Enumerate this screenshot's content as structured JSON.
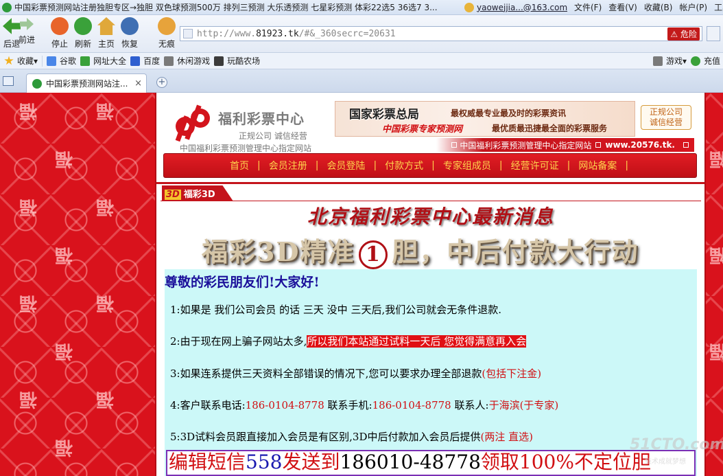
{
  "window": {
    "title": "中国彩票预测网站注册独胆专区→独胆 双色球预测500万 排列三预测 大乐透预测 七星彩预测 体彩22选5 36选7 3...",
    "user_email": "yaowejjia...@163.com",
    "menu": [
      "文件(F)",
      "查看(V)",
      "收藏(B)",
      "帐户(P)",
      "工具"
    ]
  },
  "toolbar": {
    "buttons": [
      {
        "label": "后退",
        "icon": "back-arrow-icon",
        "color": "#3a9c2f"
      },
      {
        "label": "前进",
        "icon": "forward-arrow-icon",
        "color": "#9fc798"
      },
      {
        "label": "停止",
        "icon": "stop-icon",
        "color": "#e8642a"
      },
      {
        "label": "刷新",
        "icon": "refresh-icon",
        "color": "#3aa13a"
      },
      {
        "label": "主页",
        "icon": "home-icon",
        "color": "#e0a83a"
      },
      {
        "label": "恢复",
        "icon": "restore-icon",
        "color": "#3f6fb3"
      },
      {
        "label": "无痕",
        "icon": "paw-icon",
        "color": "#e7a33b"
      }
    ],
    "address": {
      "prefix": "http://www.",
      "domain": "81923.tk",
      "suffix": "/#&_360secrc=20631",
      "danger_label": "危险"
    }
  },
  "favorites": {
    "items": [
      "收藏",
      "谷歌",
      "网址大全",
      "百度",
      "休闲游戏",
      "玩酷农场"
    ],
    "right": [
      "游戏",
      "充值"
    ]
  },
  "tabs": {
    "active_title": "中国彩票预测网站注...",
    "close": "×",
    "new": "+"
  },
  "site": {
    "logo_name": "福利彩票中心",
    "logo_slogan": "正规公司 诚信经营",
    "logo_sub": "中国福利彩票预测管理中心指定网站",
    "banner_title": "国家彩票总局",
    "banner_sub": "中国彩票专家预测网",
    "banner_t1": "最权威最专业最及时的彩票资讯",
    "banner_t2": "最优质最迅捷最全面的彩票服务",
    "badge_line1": "正规公司",
    "badge_line2": "诚信经营",
    "strip_text": "中国福利彩票预测管理中心指定网站",
    "strip_url": "www.20576.tk.",
    "nav": [
      "首页",
      "会员注册",
      "会员登陆",
      "付款方式",
      "专家组成员",
      "经营许可证",
      "网站备案"
    ],
    "nav_sep": "|"
  },
  "content": {
    "section_3d": "3D",
    "section_label": "福彩3D",
    "headline": "北京福利彩票中心最新消息",
    "slogan_pre": "福彩3D精准",
    "slogan_num": "1",
    "slogan_post": "胆，中后付款大行动",
    "greeting": "尊敬的彩民朋友们!大家好!",
    "line1": "1:如果是 我们公司会员 的话 三天 没中 三天后,我们公司就会无条件退款.",
    "line2_a": "2:由于现在网上骗子网站太多,",
    "line2_b": "所以我们本站通过试料一天后 您觉得满意再入会",
    "line3_a": "3:如果连系提供三天资料全部错误的情况下,您可以要求办理全部退款",
    "line3_b": "(包括下注金)",
    "line4_a": "4:客户联系电话:",
    "line4_phone1": "186-0104-8778",
    "line4_b": " 联系手机:",
    "line4_phone2": "186-0104-8778",
    "line4_c": " 联系人:",
    "line4_contact": "于海滨(于专家)",
    "line5_a": "5:3D试料会员跟直接加入会员是有区别,3D中后付款加入会员后提供",
    "line5_b": "(两注 直选)",
    "sms_a": "编辑短信",
    "sms_num": "558",
    "sms_b": "发送到",
    "sms_phone": "186010-48778",
    "sms_c": "领取100%不定位胆"
  },
  "watermark": {
    "main": "51CTO.com",
    "sub": "技术成就梦想"
  },
  "colors": {
    "page_red": "#d9121c",
    "nav_text": "#ffd34d",
    "notice_bg": "#ccf8f8",
    "greeting": "#1a0f9a"
  }
}
